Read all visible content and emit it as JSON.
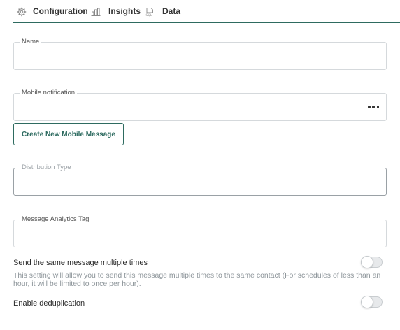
{
  "tabs": {
    "configuration": {
      "label": "Configuration",
      "icon": "gear-icon",
      "active": true
    },
    "insights": {
      "label": "Insights",
      "icon": "bar-chart-icon"
    },
    "data": {
      "label": "Data",
      "icon": "sql-database-icon"
    }
  },
  "form": {
    "name": {
      "legend": "Name",
      "value": ""
    },
    "mobile_notification": {
      "legend": "Mobile notification",
      "value": "",
      "menu_icon": "more-horizontal-icon"
    },
    "create_button": {
      "label": "Create New Mobile Message"
    },
    "distribution_type": {
      "legend": "Distribution Type",
      "value": ""
    },
    "analytics_tag": {
      "legend": "Message Analytics Tag",
      "value": ""
    }
  },
  "settings": {
    "send_multiple": {
      "label": "Send the same message multiple times",
      "description": "This setting will allow you to send this message multiple times to the same contact (For schedules of less than an hour, it will be limited to once per hour).",
      "enabled": false
    },
    "deduplication": {
      "label": "Enable deduplication",
      "enabled": false
    }
  },
  "colors": {
    "accent": "#2e6b60",
    "muted_text": "#8d959a",
    "border": "#d5d9dc"
  }
}
